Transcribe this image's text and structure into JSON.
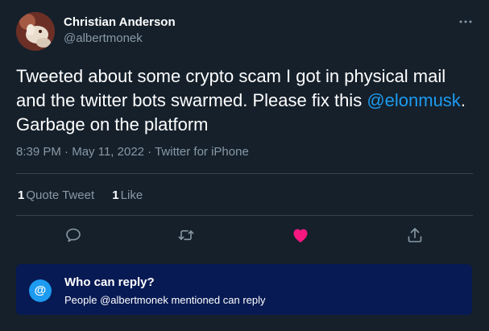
{
  "author": {
    "display_name": "Christian Anderson",
    "handle": "@albertmonek"
  },
  "tweet": {
    "text_before_mention": "Tweeted about some crypto scam I got in physical mail and the twitter bots swarmed. Please fix this ",
    "mention": "@elonmusk",
    "text_after_mention": ". Garbage on the platform",
    "time": "8:39 PM",
    "separator": "·",
    "date": "May 11, 2022",
    "source": "Twitter for iPhone"
  },
  "stats": {
    "quote_tweets_count": "1",
    "quote_tweets_label": "Quote Tweet",
    "likes_count": "1",
    "likes_label": "Like"
  },
  "actions": {
    "reply_icon": "reply-icon",
    "retweet_icon": "retweet-icon",
    "like_icon": "heart-icon",
    "share_icon": "share-icon",
    "liked": true
  },
  "reply_settings": {
    "badge": "@",
    "title": "Who can reply?",
    "description": "People @albertmonek mentioned can reply"
  },
  "colors": {
    "background": "#15202b",
    "accent": "#1d9bf0",
    "like": "#f91880",
    "muted": "#8899a6",
    "reply_box": "#071a54"
  }
}
